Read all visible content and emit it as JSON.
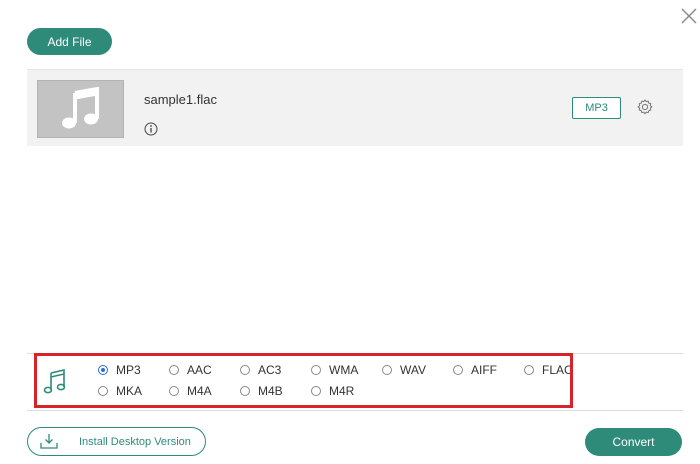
{
  "toolbar": {
    "add_file_label": "Add File"
  },
  "file": {
    "name": "sample1.flac",
    "output_format": "MP3"
  },
  "formats": {
    "selected": "MP3",
    "options": [
      "MP3",
      "AAC",
      "AC3",
      "WMA",
      "WAV",
      "AIFF",
      "FLAC",
      "MKA",
      "M4A",
      "M4B",
      "M4R"
    ]
  },
  "footer": {
    "install_label": "Install Desktop Version",
    "convert_label": "Convert"
  },
  "colors": {
    "accent": "#2e8b7a",
    "highlight": "#d9232a",
    "radio_selected": "#2a6fd6"
  },
  "icons": [
    "close-icon",
    "music-note-icon",
    "info-icon",
    "gear-icon",
    "download-icon"
  ]
}
